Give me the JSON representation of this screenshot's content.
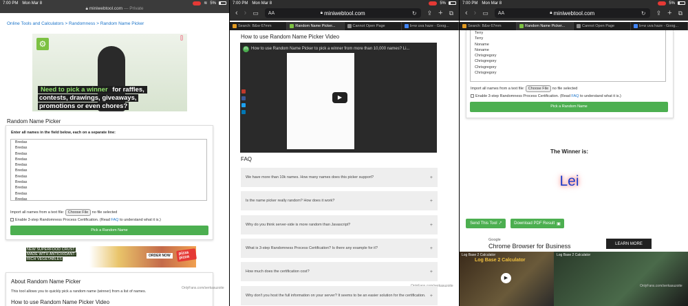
{
  "pane1": {
    "status_time": "7:00 PM",
    "status_date": "Mon Mar 8",
    "battery": "5%",
    "url": "miniwebtool.com",
    "url_suffix": "— Private",
    "breadcrumb": "Online Tools and Calculators > Randomness > Random Name Picker",
    "hero_caption_line1_green": "Need to pick a winner",
    "hero_caption_line1_rest": " for raffles,",
    "hero_caption_line2": "contests, drawings, giveaways,",
    "hero_caption_line3": "promotions or even chores?",
    "tool_title": "Random Name Picker",
    "names_label": "Enter all names in the field below, each on a separate line:",
    "names": [
      "Bredas",
      "Bredas",
      "Bredas",
      "Bredas",
      "Bredas",
      "Bredas",
      "Bredas",
      "Bredas",
      "Bredas",
      "Bredas",
      "Bredas"
    ],
    "import_label": "Import all names from a text file:",
    "choose_file": "Choose File",
    "no_file": "no file selected",
    "cert_text": "Enable 3-step Randomness Process Certification. (Read",
    "faq_link": "FAQ",
    "cert_text_end": "to understand what it is.)",
    "pick_button": "Pick a Random Name",
    "ad_line1": "NEW SUPERFOOD CRUST",
    "ad_line2": "MADE WITH ANTIOXIDANT-",
    "ad_line3": "RICH VEGETABLES",
    "ad_order": "ORDER NOW",
    "ad_brand": "pizza pizza",
    "watermark": "OnlyFans.com/serkasuzoite",
    "about_title": "About Random Name Picker",
    "about_text": "This tool allows you to quickly pick a random name (winner) from a list of names.",
    "howto_title": "How to use Random Name Picker Video"
  },
  "pane2": {
    "status_time": "7:00 PM",
    "status_date": "Mon Mar 8",
    "battery": "5%",
    "url": "miniwebtool.com",
    "aa": "AA",
    "tabs": [
      "Search: B&w 67mm",
      "Random Name Picker...",
      "Cannot Open Page",
      "b+w uva haze - Goog..."
    ],
    "howto_title": "How to use Random Name Picker Video",
    "video_title": "How to use Random Name Picker to pick a winner from more than 10,000 names? Li...",
    "faq_title": "FAQ",
    "faqs": [
      "We have more than 10k names. How many names does this picker support?",
      "Is the name picker really random? How does it work?",
      "Why do you think server-side is more random than Javascript?",
      "What is 3-step Randomness Process Certification? Is there any example for it?",
      "How much does the certification cost?",
      "Why don't you host the full information on your server? It seems to be an easier solution for the certification."
    ],
    "watermark": "OnlyFans.com/serkasuzoite"
  },
  "pane3": {
    "status_time": "7:00 PM",
    "status_date": "Mon Mar 8",
    "battery": "5%",
    "url": "miniwebtool.com",
    "aa": "AA",
    "tabs": [
      "Search: B&w 67mm",
      "Random Name Picker...",
      "Cannot Open Page",
      "b+w uva haze - Goog..."
    ],
    "names": [
      "Terry",
      "Terry",
      "Noname",
      "Noname",
      "Chrisgregory",
      "Chrisgregory",
      "Chrisgregory",
      "Chrisgregory"
    ],
    "import_label": "Import all names from a text file:",
    "choose_file": "Choose File",
    "no_file": "no file selected",
    "cert_text": "Enable 3-step Randomness Process Certification. (Read",
    "faq_link": "FAQ",
    "cert_text_end": "to understand what it is.)",
    "pick_button": "Pick a Random Name",
    "winner_label": "The Winner is:",
    "winner": "Lei",
    "send_button": "Send This Tool",
    "download_button": "Download PDF Result",
    "ad_brand": "Google",
    "ad_title": "Chrome Browser for Business",
    "learn_more": "LEARN MORE",
    "video_left": "Log Base 2 Calculator",
    "video_left_sub": "Log Base 2 Calculator",
    "video_right": "Log Base 2 Calculator",
    "watermark": "OnlyFans.com/serkasuzoite"
  },
  "colors": {
    "accent_green": "#4caf50",
    "link": "#1a73c9",
    "winner": "#1d3ec8"
  }
}
